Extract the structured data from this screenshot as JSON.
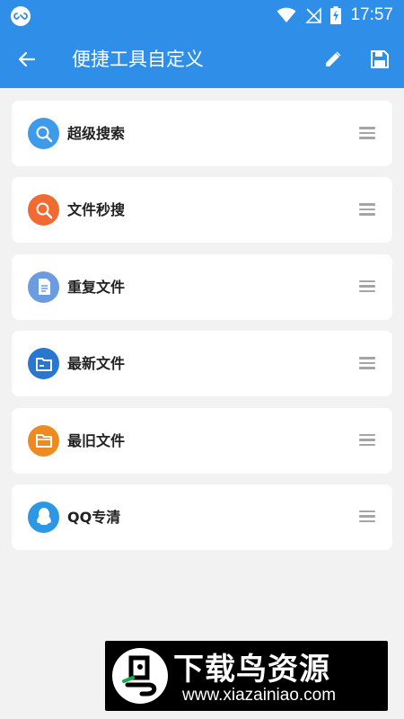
{
  "status_bar": {
    "time": "17:57",
    "icons": [
      "app-logo-icon",
      "wifi-icon",
      "no-signal-icon",
      "battery-charging-icon"
    ]
  },
  "app_bar": {
    "title": "便捷工具自定义",
    "icons": [
      "back-arrow-icon",
      "edit-pencil-icon",
      "save-floppy-icon"
    ]
  },
  "tools": [
    {
      "label": "超级搜索",
      "icon": "search-icon",
      "color": "#3d9be9"
    },
    {
      "label": "文件秒搜",
      "icon": "search-icon",
      "color": "#f06a32"
    },
    {
      "label": "重复文件",
      "icon": "document-icon",
      "color": "#6b9be0"
    },
    {
      "label": "最新文件",
      "icon": "folder-icon",
      "color": "#2878d0"
    },
    {
      "label": "最旧文件",
      "icon": "folder-open-icon",
      "color": "#ee8a22"
    },
    {
      "label": "QQ专清",
      "icon": "qq-penguin-icon",
      "color": "#2b97e5"
    }
  ],
  "watermark": {
    "title": "下载鸟资源",
    "url": "www.xiazainiao.com"
  },
  "colors": {
    "primary": "#2f8ee8",
    "background": "#f2f2f2",
    "card": "#ffffff"
  }
}
